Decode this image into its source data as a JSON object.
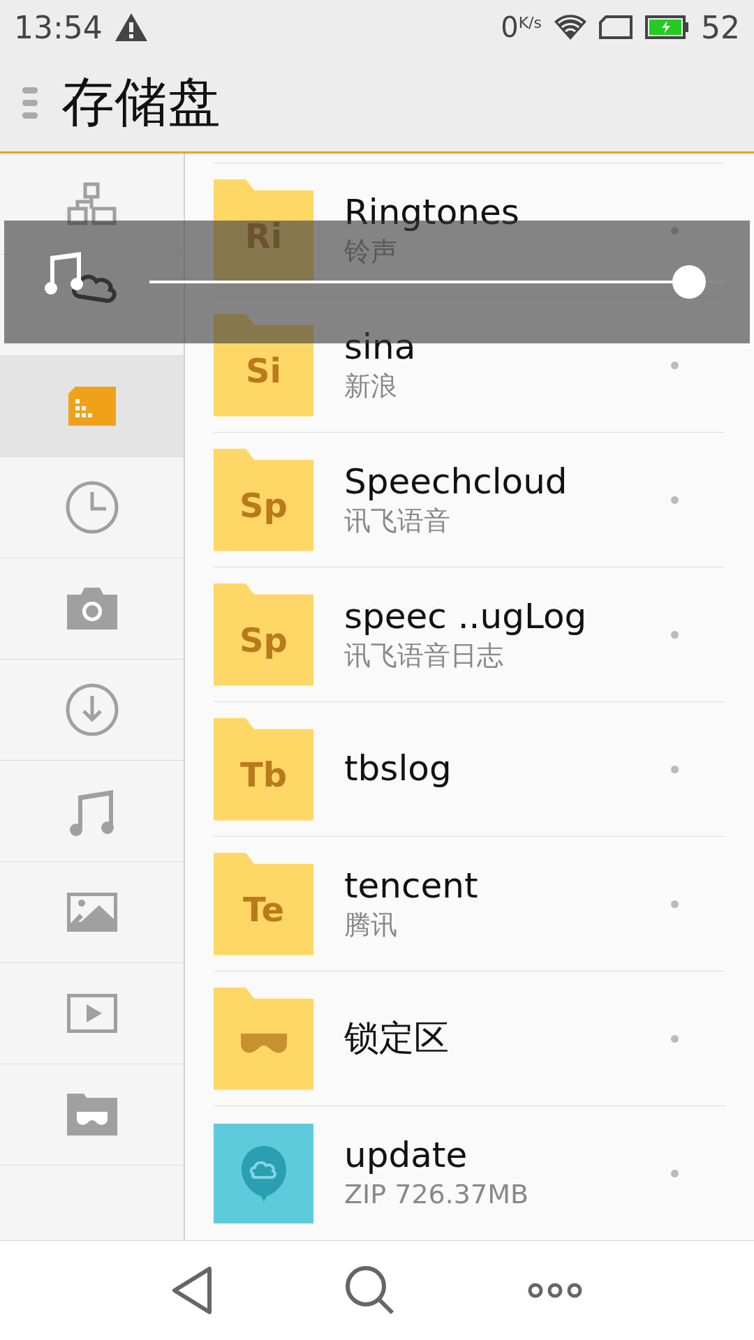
{
  "status_bar": {
    "time": "13:54",
    "speed_value": "0",
    "speed_unit": "K/s",
    "battery": "52"
  },
  "header": {
    "title": "存储盘"
  },
  "sidebar": {
    "items": [
      {
        "selected": false
      },
      {
        "selected": false
      },
      {
        "selected": true
      },
      {
        "selected": false
      },
      {
        "selected": false
      },
      {
        "selected": false
      },
      {
        "selected": false
      },
      {
        "selected": false
      },
      {
        "selected": false
      },
      {
        "selected": false
      }
    ]
  },
  "files": [
    {
      "kind": "folder",
      "label": "Ri",
      "name": "Ringtones",
      "subtitle": "铃声"
    },
    {
      "kind": "folder",
      "label": "Si",
      "name": "sina",
      "subtitle": "新浪"
    },
    {
      "kind": "folder",
      "label": "Sp",
      "name": "Speechcloud",
      "subtitle": "讯飞语音"
    },
    {
      "kind": "folder",
      "label": "Sp",
      "name": "speec ..ugLog",
      "subtitle": "讯飞语音日志"
    },
    {
      "kind": "folder",
      "label": "Tb",
      "name": "tbslog"
    },
    {
      "kind": "folder",
      "label": "Te",
      "name": "tencent",
      "subtitle": "腾讯"
    },
    {
      "kind": "locked",
      "name": "锁定区"
    },
    {
      "kind": "zip",
      "name": "update",
      "subtitle": "ZIP 726.37MB"
    }
  ],
  "volume": {
    "level": 0.94
  }
}
